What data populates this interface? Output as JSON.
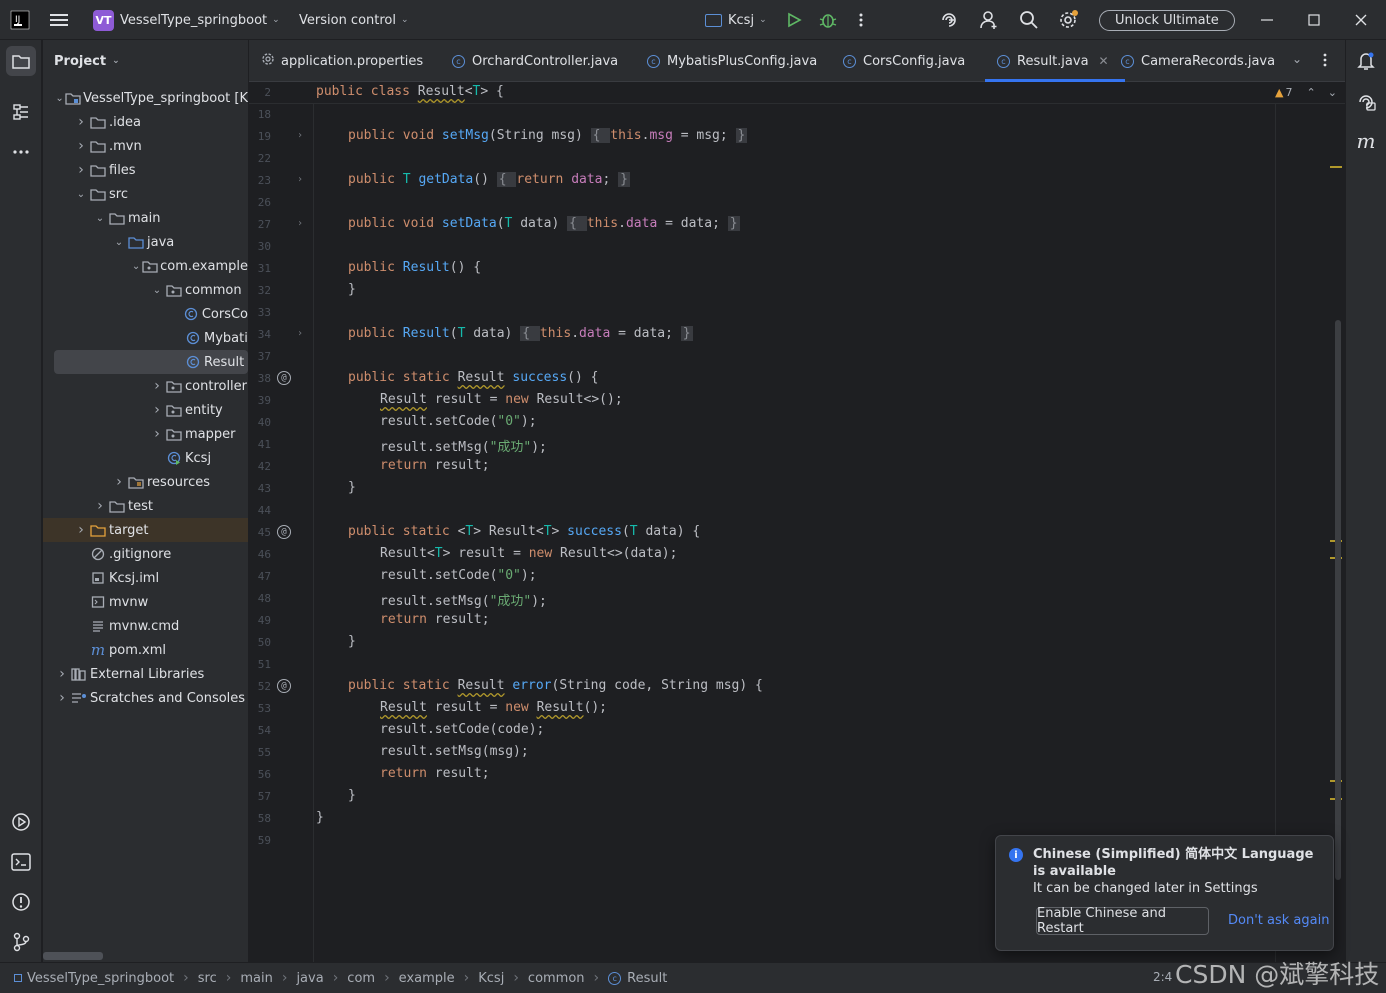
{
  "titlebar": {
    "project_badge": "VT",
    "project_name": "VesselType_springboot",
    "version_control": "Version control",
    "run_config": "Kcsj",
    "unlock": "Unlock Ultimate"
  },
  "project_panel": {
    "title": "Project",
    "tree": [
      {
        "label": "VesselType_springboot [K",
        "depth": 0,
        "chevron": "down",
        "icon": "folder-module"
      },
      {
        "label": ".idea",
        "depth": 1,
        "chevron": "right",
        "icon": "folder"
      },
      {
        "label": ".mvn",
        "depth": 1,
        "chevron": "right",
        "icon": "folder"
      },
      {
        "label": "files",
        "depth": 1,
        "chevron": "right",
        "icon": "folder"
      },
      {
        "label": "src",
        "depth": 1,
        "chevron": "down",
        "icon": "folder"
      },
      {
        "label": "main",
        "depth": 2,
        "chevron": "down",
        "icon": "folder"
      },
      {
        "label": "java",
        "depth": 3,
        "chevron": "down",
        "icon": "folder-source"
      },
      {
        "label": "com.example",
        "depth": 4,
        "chevron": "down",
        "icon": "package"
      },
      {
        "label": "common",
        "depth": 5,
        "chevron": "down",
        "icon": "package"
      },
      {
        "label": "CorsCo",
        "depth": 6,
        "chevron": "",
        "icon": "class"
      },
      {
        "label": "Mybati",
        "depth": 6,
        "chevron": "",
        "icon": "class"
      },
      {
        "label": "Result",
        "depth": 6,
        "chevron": "",
        "icon": "class",
        "selected": true
      },
      {
        "label": "controller",
        "depth": 5,
        "chevron": "right",
        "icon": "package"
      },
      {
        "label": "entity",
        "depth": 5,
        "chevron": "right",
        "icon": "package"
      },
      {
        "label": "mapper",
        "depth": 5,
        "chevron": "right",
        "icon": "package"
      },
      {
        "label": "Kcsj",
        "depth": 5,
        "chevron": "",
        "icon": "class-run"
      },
      {
        "label": "resources",
        "depth": 3,
        "chevron": "right",
        "icon": "folder-resources"
      },
      {
        "label": "test",
        "depth": 2,
        "chevron": "right",
        "icon": "folder"
      },
      {
        "label": "target",
        "depth": 1,
        "chevron": "right",
        "icon": "folder-excluded",
        "highlight": true
      },
      {
        "label": ".gitignore",
        "depth": 1,
        "chevron": "",
        "icon": "ignore-file"
      },
      {
        "label": "Kcsj.iml",
        "depth": 1,
        "chevron": "",
        "icon": "iml-file"
      },
      {
        "label": "mvnw",
        "depth": 1,
        "chevron": "",
        "icon": "terminal-file"
      },
      {
        "label": "mvnw.cmd",
        "depth": 1,
        "chevron": "",
        "icon": "text-file"
      },
      {
        "label": "pom.xml",
        "depth": 1,
        "chevron": "",
        "icon": "maven-file"
      },
      {
        "label": "External Libraries",
        "depth": 0,
        "chevron": "right",
        "icon": "library"
      },
      {
        "label": "Scratches and Consoles",
        "depth": 0,
        "chevron": "right",
        "icon": "scratches"
      }
    ]
  },
  "tabs": [
    {
      "label": "application.properties",
      "icon": "gear-icon",
      "active": false
    },
    {
      "label": "OrchardController.java",
      "icon": "class-icon",
      "active": false
    },
    {
      "label": "MybatisPlusConfig.java",
      "icon": "class-icon",
      "active": false
    },
    {
      "label": "CorsConfig.java",
      "icon": "class-icon",
      "active": false
    },
    {
      "label": "Result.java",
      "icon": "class-icon",
      "active": true
    },
    {
      "label": "CameraRecords.java",
      "icon": "class-icon",
      "active": false
    }
  ],
  "editor": {
    "warnings": "7",
    "line_numbers": [
      "2",
      "18",
      "19",
      "22",
      "23",
      "26",
      "27",
      "30",
      "31",
      "32",
      "33",
      "34",
      "37",
      "38",
      "39",
      "40",
      "41",
      "42",
      "43",
      "44",
      "45",
      "46",
      "47",
      "48",
      "49",
      "50",
      "51",
      "52",
      "53",
      "54",
      "55",
      "56",
      "57",
      "58",
      "59"
    ]
  },
  "notification": {
    "title": "Chinese (Simplified) 简体中文 Language is available",
    "body": "It can be changed later in Settings",
    "primary_action": "Enable Chinese and Restart",
    "secondary_action": "Don't ask again"
  },
  "statusbar": {
    "breadcrumbs": [
      "VesselType_springboot",
      "src",
      "main",
      "java",
      "com",
      "example",
      "Kcsj",
      "common",
      "Result"
    ],
    "position": "2:4",
    "watermark": "CSDN @斌擎科技"
  },
  "colors": {
    "background": "#1e1f22",
    "panel": "#2b2d30",
    "accent": "#3574f0",
    "keyword": "#cf8e6d",
    "function": "#56a8f5",
    "string": "#6aab73"
  }
}
